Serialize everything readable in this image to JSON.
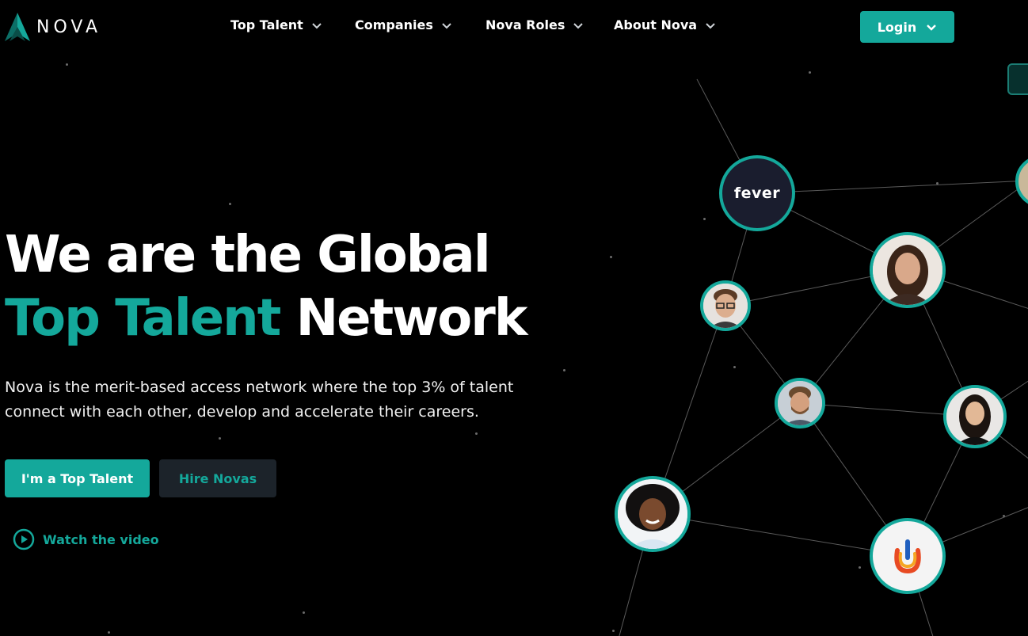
{
  "brand": {
    "name": "NOVA",
    "accent": "#14a89b"
  },
  "nav": [
    {
      "label": "Top Talent"
    },
    {
      "label": "Companies"
    },
    {
      "label": "Nova Roles"
    },
    {
      "label": "About Nova"
    }
  ],
  "login": {
    "label": "Login"
  },
  "hero": {
    "line1": "We are the Global",
    "line2_highlight": "Top Talent",
    "line2_rest": "Network",
    "description": "Nova is the merit-based access network where the top 3% of talent connect with each other, develop and accelerate their careers.",
    "primary_cta": "I'm a Top Talent",
    "secondary_cta": "Hire Novas",
    "video_link": "Watch the video"
  },
  "network": {
    "logo_fever": "fever"
  }
}
